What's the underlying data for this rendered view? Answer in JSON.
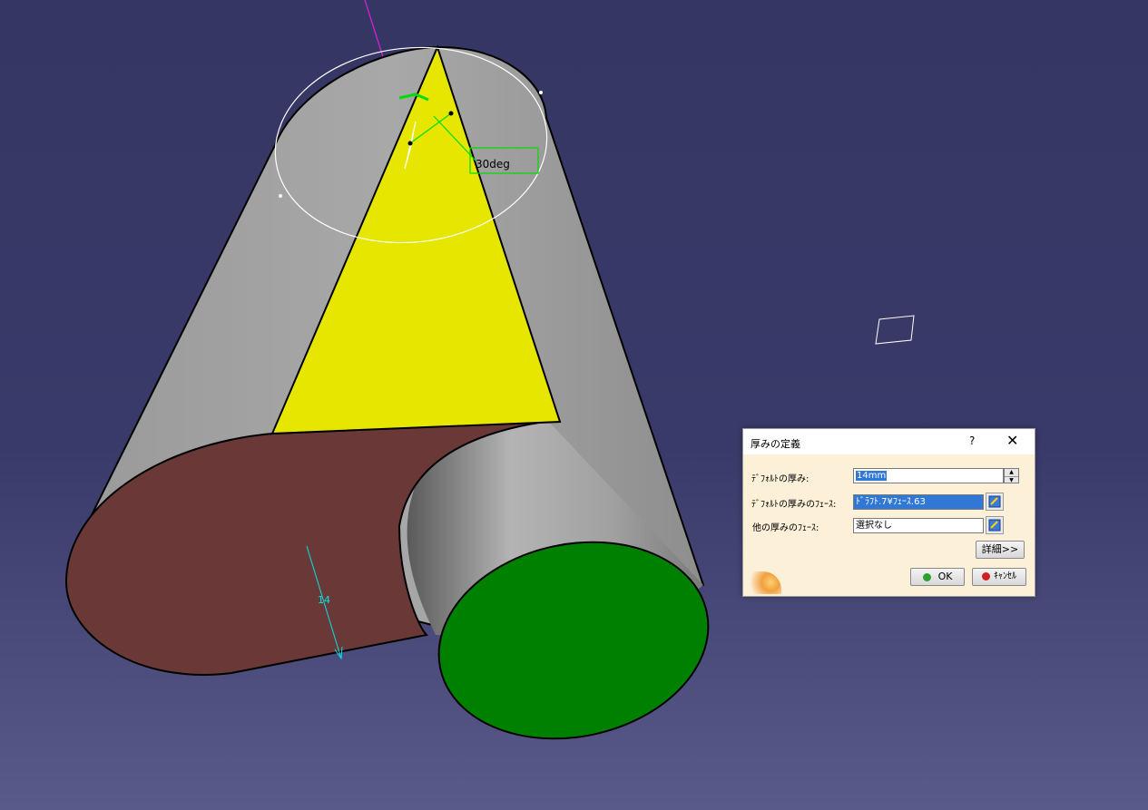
{
  "viewport": {
    "angle_label": "30deg",
    "thickness_label": "14",
    "colors": {
      "background": "#363664",
      "cylinder": "#a3a3a3",
      "draft_face": "#e6e600",
      "thick_face": "#6b3838",
      "cap_face": "#008000",
      "constraint": "#00dd00"
    }
  },
  "dialog": {
    "title": "厚みの定義",
    "help_icon": "?",
    "close_icon": "✕",
    "default_thickness_label": "ﾃﾞﾌｫﾙﾄの厚み:",
    "default_thickness_value": "14mm",
    "default_faces_label": "ﾃﾞﾌｫﾙﾄの厚みのﾌｪｰｽ:",
    "default_faces_value": "ﾄﾞﾗﾌﾄ.7¥ﾌｪｰｽ.63",
    "other_faces_label": "他の厚みのﾌｪｰｽ:",
    "other_faces_value": "選択なし",
    "more_button": "詳細>>",
    "ok_button": "OK",
    "cancel_button": "ｷｬﾝｾﾙ"
  }
}
